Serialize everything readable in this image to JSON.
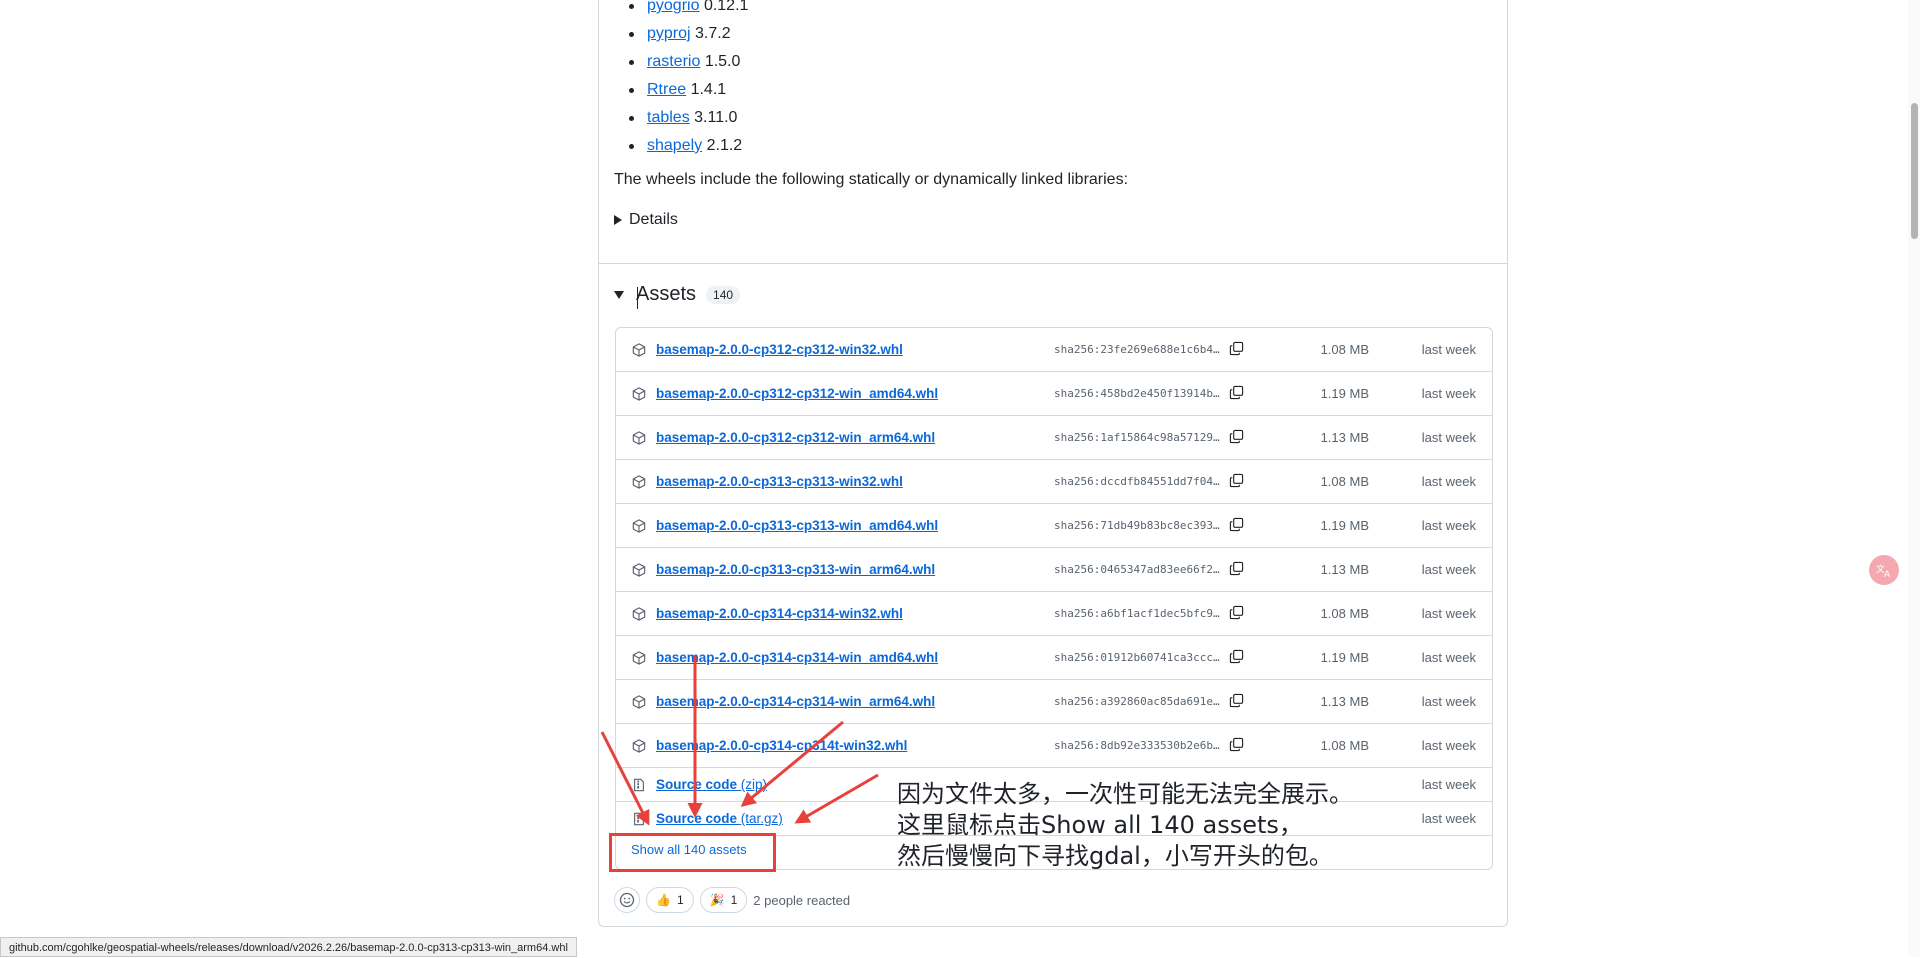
{
  "packages": [
    {
      "name": "pyogrio",
      "version": "0.12.1"
    },
    {
      "name": "pyproj",
      "version": "3.7.2"
    },
    {
      "name": "rasterio",
      "version": "1.5.0"
    },
    {
      "name": "Rtree",
      "version": "1.4.1"
    },
    {
      "name": "tables",
      "version": "3.11.0"
    },
    {
      "name": "shapely",
      "version": "2.1.2"
    }
  ],
  "wheels_text": "The wheels include the following statically or dynamically linked libraries:",
  "details_label": "Details",
  "assets": {
    "title": "Assets",
    "count": "140",
    "rows": [
      {
        "name": "basemap-2.0.0-cp312-cp312-win32.whl",
        "sha": "sha256:23fe269e688e1c6b4…",
        "size": "1.08 MB",
        "date": "last week"
      },
      {
        "name": "basemap-2.0.0-cp312-cp312-win_amd64.whl",
        "sha": "sha256:458bd2e450f13914b…",
        "size": "1.19 MB",
        "date": "last week"
      },
      {
        "name": "basemap-2.0.0-cp312-cp312-win_arm64.whl",
        "sha": "sha256:1af15864c98a57129…",
        "size": "1.13 MB",
        "date": "last week"
      },
      {
        "name": "basemap-2.0.0-cp313-cp313-win32.whl",
        "sha": "sha256:dccdfb84551dd7f04…",
        "size": "1.08 MB",
        "date": "last week"
      },
      {
        "name": "basemap-2.0.0-cp313-cp313-win_amd64.whl",
        "sha": "sha256:71db49b83bc8ec393…",
        "size": "1.19 MB",
        "date": "last week"
      },
      {
        "name": "basemap-2.0.0-cp313-cp313-win_arm64.whl",
        "sha": "sha256:0465347ad83ee66f2…",
        "size": "1.13 MB",
        "date": "last week"
      },
      {
        "name": "basemap-2.0.0-cp314-cp314-win32.whl",
        "sha": "sha256:a6bf1acf1dec5bfc9…",
        "size": "1.08 MB",
        "date": "last week"
      },
      {
        "name": "basemap-2.0.0-cp314-cp314-win_amd64.whl",
        "sha": "sha256:01912b60741ca3ccc…",
        "size": "1.19 MB",
        "date": "last week"
      },
      {
        "name": "basemap-2.0.0-cp314-cp314-win_arm64.whl",
        "sha": "sha256:a392860ac85da691e…",
        "size": "1.13 MB",
        "date": "last week"
      },
      {
        "name": "basemap-2.0.0-cp314-cp314t-win32.whl",
        "sha": "sha256:8db92e333530b2e6b…",
        "size": "1.08 MB",
        "date": "last week"
      }
    ],
    "source_rows": [
      {
        "label": "Source code",
        "sub": "(zip)",
        "date": "last week"
      },
      {
        "label": "Source code",
        "sub": "(tar.gz)",
        "date": "last week"
      }
    ],
    "show_all": "Show all 140 assets"
  },
  "annotation": [
    "因为文件太多，一次性可能无法完全展示。",
    "这里鼠标点击Show all 140 assets，",
    "然后慢慢向下寻找gdal，小写开头的包。"
  ],
  "reactions": [
    {
      "icon": "thumbs-up",
      "emoji": "👍",
      "count": "1"
    },
    {
      "icon": "party-popper",
      "emoji": "🎉",
      "count": "1"
    }
  ],
  "reactions_text": "2 people reacted",
  "status_url": "github.com/cgohlke/geospatial-wheels/releases/download/v2026.2.26/basemap-2.0.0-cp313-cp313-win_arm64.whl",
  "colors": {
    "link": "#0969da",
    "annotation_red": "#e8413c"
  }
}
